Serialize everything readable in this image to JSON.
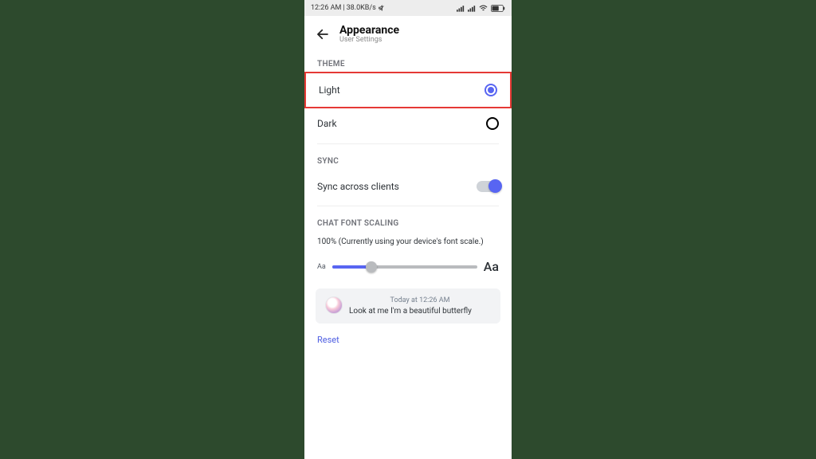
{
  "status": {
    "time": "12:26 AM",
    "speed": "38.0KB/s"
  },
  "header": {
    "title": "Appearance",
    "subtitle": "User Settings"
  },
  "sections": {
    "theme": {
      "label": "THEME",
      "options": [
        {
          "label": "Light",
          "selected": true,
          "highlighted": true
        },
        {
          "label": "Dark",
          "selected": false,
          "highlighted": false
        }
      ]
    },
    "sync": {
      "label": "SYNC",
      "option_label": "Sync across clients",
      "enabled": true
    },
    "font_scaling": {
      "label": "CHAT FONT SCALING",
      "value_text": "100% (Currently using your device's font scale.)",
      "small_aa": "Aa",
      "large_aa": "Aa",
      "slider_percent": 27
    }
  },
  "preview": {
    "timestamp": "Today at 12:26 AM",
    "message": "Look at me I'm a beautiful butterfly"
  },
  "reset_label": "Reset"
}
